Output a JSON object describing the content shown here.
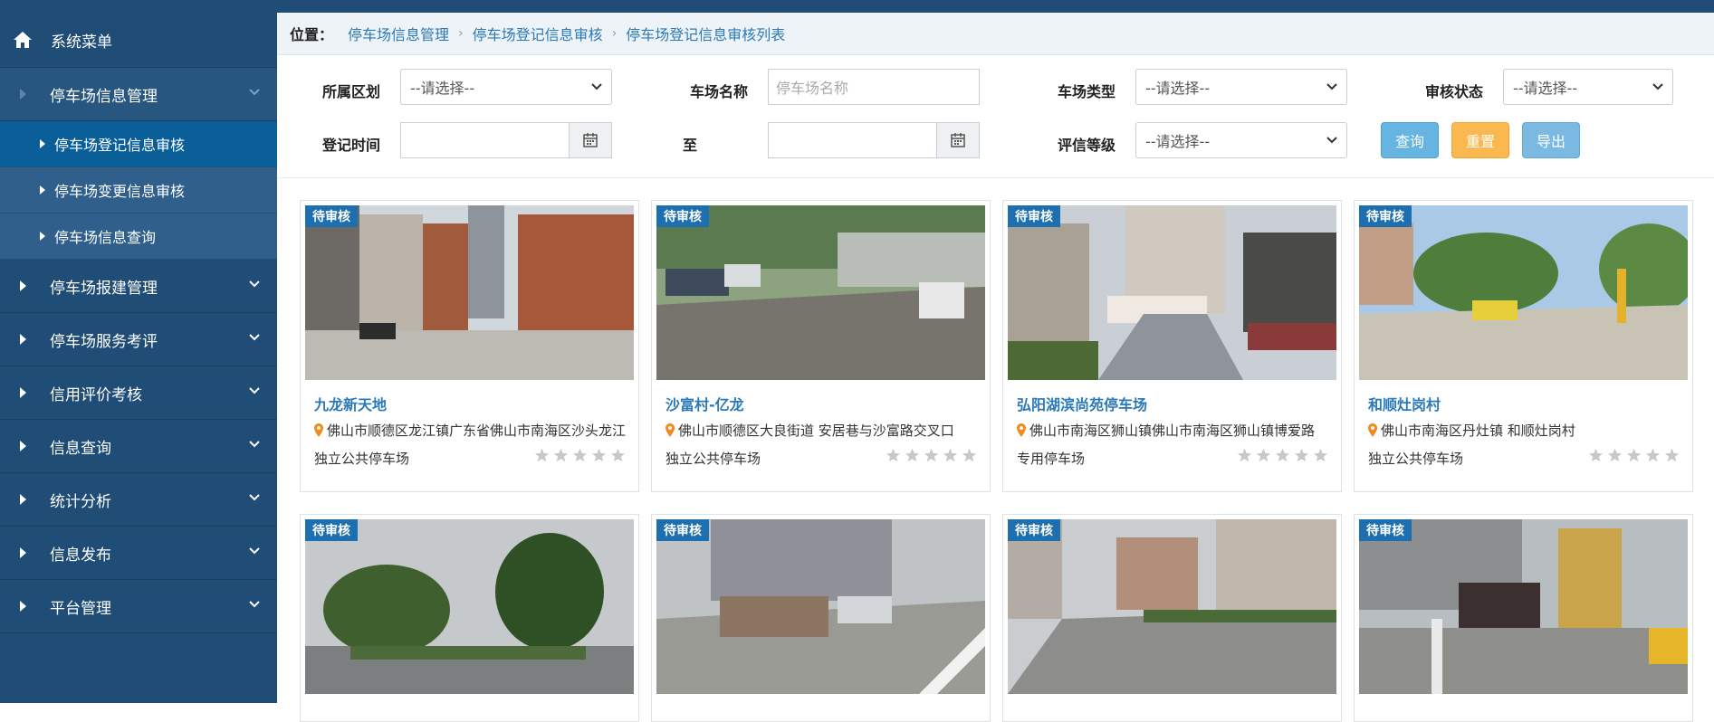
{
  "sidebar": {
    "header": "系统菜单",
    "groups": [
      {
        "label": "停车场信息管理"
      },
      {
        "label": "停车场报建管理"
      },
      {
        "label": "停车场服务考评"
      },
      {
        "label": "信用评价考核"
      },
      {
        "label": "信息查询"
      },
      {
        "label": "统计分析"
      },
      {
        "label": "信息发布"
      },
      {
        "label": "平台管理"
      }
    ],
    "subitems": [
      {
        "label": "停车场登记信息审核"
      },
      {
        "label": "停车场变更信息审核"
      },
      {
        "label": "停车场信息查询"
      }
    ]
  },
  "breadcrumb": {
    "label": "位置：",
    "items": [
      "停车场信息管理",
      "停车场登记信息审核",
      "停车场登记信息审核列表"
    ]
  },
  "filters": {
    "district_label": "所属区划",
    "district_value": "--请选择--",
    "name_label": "车场名称",
    "name_placeholder": "停车场名称",
    "type_label": "车场类型",
    "type_value": "--请选择--",
    "status_label": "审核状态",
    "status_value": "--请选择--",
    "time_label": "登记时间",
    "to_label": "至",
    "rating_label": "评信等级",
    "rating_value": "--请选择--",
    "query_button": "查询",
    "reset_button": "重置",
    "export_button": "导出"
  },
  "cards": [
    {
      "badge": "待审核",
      "name": "九龙新天地",
      "address": "佛山市顺德区龙江镇广东省佛山市南海区沙头龙江",
      "type": "独立公共停车场",
      "rating": 0
    },
    {
      "badge": "待审核",
      "name": "沙富村-亿龙",
      "address": "佛山市顺德区大良街道 安居巷与沙富路交叉口",
      "type": "独立公共停车场",
      "rating": 0
    },
    {
      "badge": "待审核",
      "name": "弘阳湖滨尚苑停车场",
      "address": "佛山市南海区狮山镇佛山市南海区狮山镇博爱路",
      "type": "专用停车场",
      "rating": 0
    },
    {
      "badge": "待审核",
      "name": "和顺灶岗村",
      "address": "佛山市南海区丹灶镇 和顺灶岗村",
      "type": "独立公共停车场",
      "rating": 0
    },
    {
      "badge": "待审核"
    },
    {
      "badge": "待审核"
    },
    {
      "badge": "待审核"
    },
    {
      "badge": "待审核"
    }
  ],
  "colors": {
    "sidebar_bg": "#1f4d76",
    "active_item": "#0b5f99",
    "link": "#2a79b8",
    "badge": "#1e6fb0",
    "query_btn": "#65b4e2",
    "reset_btn": "#fbb84f"
  }
}
